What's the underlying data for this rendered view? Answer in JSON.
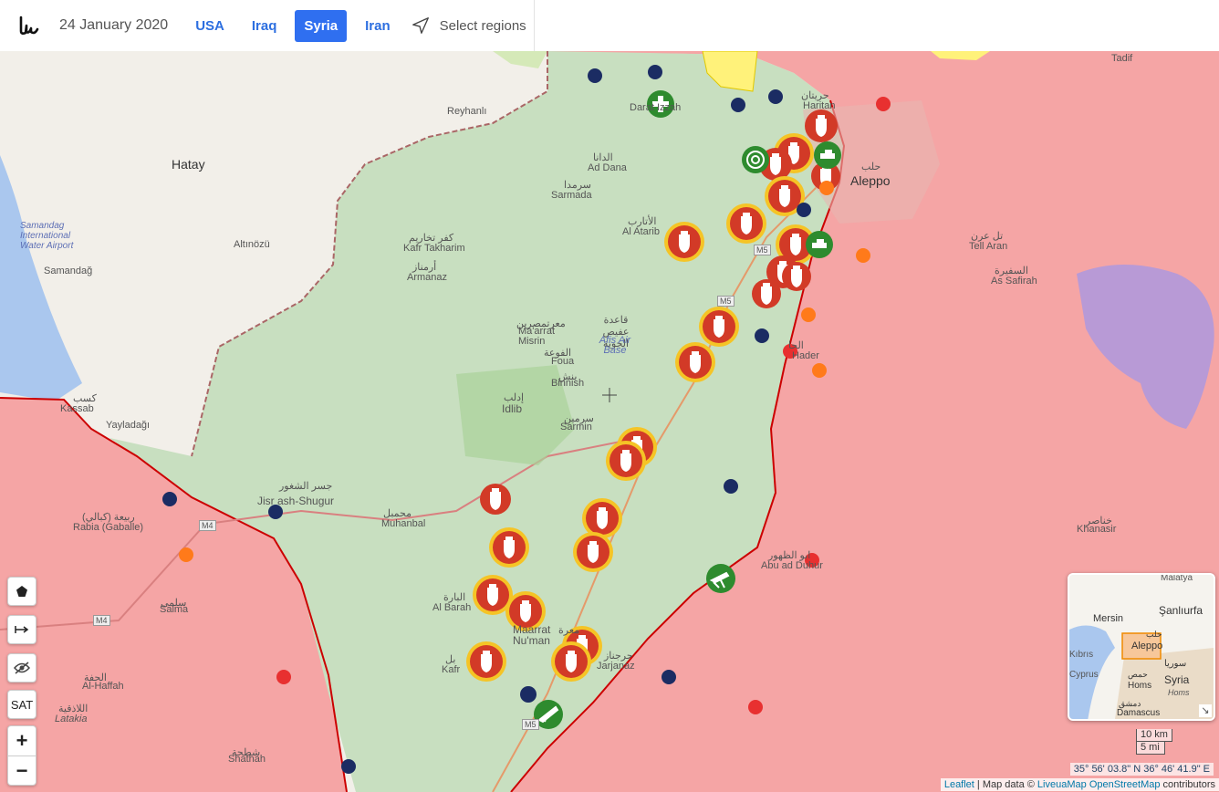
{
  "header": {
    "logo_icon": "liveuamap-logo-icon",
    "date": "24 January 2020",
    "tabs": [
      {
        "label": "USA",
        "active": false
      },
      {
        "label": "Iraq",
        "active": false
      },
      {
        "label": "Syria",
        "active": true
      },
      {
        "label": "Iran",
        "active": false
      }
    ],
    "select_regions": "Select regions",
    "select_icon": "navigation-arrow-icon"
  },
  "colors": {
    "government": "#f5a5a5",
    "rebel": "#c8dfc0",
    "turkey": "#d5e9b8",
    "kurdish": "#fff27a",
    "water": "#aac7ee",
    "airstrike": "#d23a27",
    "airstrike_ring": "#f5c426",
    "russia": "#1b2c63",
    "turkey_point": "#e83030",
    "iran": "#ff7a1a",
    "rebel_icon": "#2e8b2e"
  },
  "places": [
    {
      "name": "Hatay",
      "arabic": ""
    },
    {
      "name": "Reyhanlı",
      "arabic": ""
    },
    {
      "name": "Samandag International Water Airport",
      "arabic": ""
    },
    {
      "name": "Samandağ",
      "arabic": ""
    },
    {
      "name": "Altınözü",
      "arabic": ""
    },
    {
      "name": "Kassab",
      "arabic": "كسب"
    },
    {
      "name": "Yayladağı",
      "arabic": ""
    },
    {
      "name": "Rabia (Gaballe)",
      "arabic": "ربيعة (كبالي)"
    },
    {
      "name": "Salma",
      "arabic": "سلمى"
    },
    {
      "name": "Al-Haffah",
      "arabic": "الحفة"
    },
    {
      "name": "Latakia",
      "arabic": "اللاذقية"
    },
    {
      "name": "Shathah",
      "arabic": "شطحة"
    },
    {
      "name": "Jisr ash-Shugur",
      "arabic": "جسر الشغور"
    },
    {
      "name": "Muhanbal",
      "arabic": "محمبل"
    },
    {
      "name": "Kafr Takharim",
      "arabic": "كفر تخاريم"
    },
    {
      "name": "Armanaz",
      "arabic": "أرمناز"
    },
    {
      "name": "Ma'arrat Misrin",
      "arabic": "معرتمصرين"
    },
    {
      "name": "Foua",
      "arabic": "الفوعة"
    },
    {
      "name": "Binnish",
      "arabic": "بنش"
    },
    {
      "name": "Afis Air Base",
      "arabic": "قاعدة عفيص الجوية"
    },
    {
      "name": "Idlib",
      "arabic": "إدلب"
    },
    {
      "name": "Sarmin",
      "arabic": "سرمين"
    },
    {
      "name": "Sarmada",
      "arabic": "سرمدا"
    },
    {
      "name": "Ad Dana",
      "arabic": "الدانا"
    },
    {
      "name": "Al Atarib",
      "arabic": "الأتارب"
    },
    {
      "name": "Darat Izzah",
      "arabic": ""
    },
    {
      "name": "Haritan",
      "arabic": "حريتان"
    },
    {
      "name": "Aleppo",
      "arabic": "حلب"
    },
    {
      "name": "Tell Aran",
      "arabic": "تل عرن"
    },
    {
      "name": "As Safirah",
      "arabic": "السفيرة"
    },
    {
      "name": "Tadif",
      "arabic": ""
    },
    {
      "name": "Khanasir",
      "arabic": "خناصر"
    },
    {
      "name": "Abu ad Duhur",
      "arabic": "ابو الظهور"
    },
    {
      "name": "Al Barah",
      "arabic": "البارة"
    },
    {
      "name": "Maarrat Nu'man",
      "arabic": "معرة"
    },
    {
      "name": "Kafr",
      "arabic": "بل"
    },
    {
      "name": "Jarjanaz",
      "arabic": "جرجناز"
    },
    {
      "name": "Hader",
      "arabic": "الحا"
    }
  ],
  "roads": [
    "M5",
    "M5",
    "M4",
    "M4",
    "M5"
  ],
  "map_icons": {
    "airstrike": "airstrike-bomb-icon",
    "hospital": "hospital-cross-icon",
    "target": "target-icon",
    "tank": "tank-icon",
    "gun": "rifle-icon"
  },
  "controls": {
    "polygon_icon": "pentagon-icon",
    "measure_icon": "measure-arrow-icon",
    "hide_icon": "eye-off-icon",
    "sat_label": "SAT",
    "zoom_in": "+",
    "zoom_out": "−"
  },
  "minimap": {
    "labels": [
      "Malatya",
      "Şanlıurfa",
      "Mersin",
      "Aleppo",
      "Syria",
      "Homs",
      "Homs",
      "Damascus",
      "Kıbrıs",
      "Kuzey",
      "Cyprus",
      "سوريا",
      "حمص",
      "حلب",
      "دمشق"
    ]
  },
  "scale": {
    "km": "10 km",
    "mi": "5 mi"
  },
  "coordinates": "35° 56' 03.8\" N 36° 46' 41.9\" E",
  "attribution": {
    "leaflet": "Leaflet",
    "data": " | Map data © ",
    "liveuamap": "LiveuaMap",
    "osm": "OpenStreetMap",
    "contributors": " contributors"
  }
}
